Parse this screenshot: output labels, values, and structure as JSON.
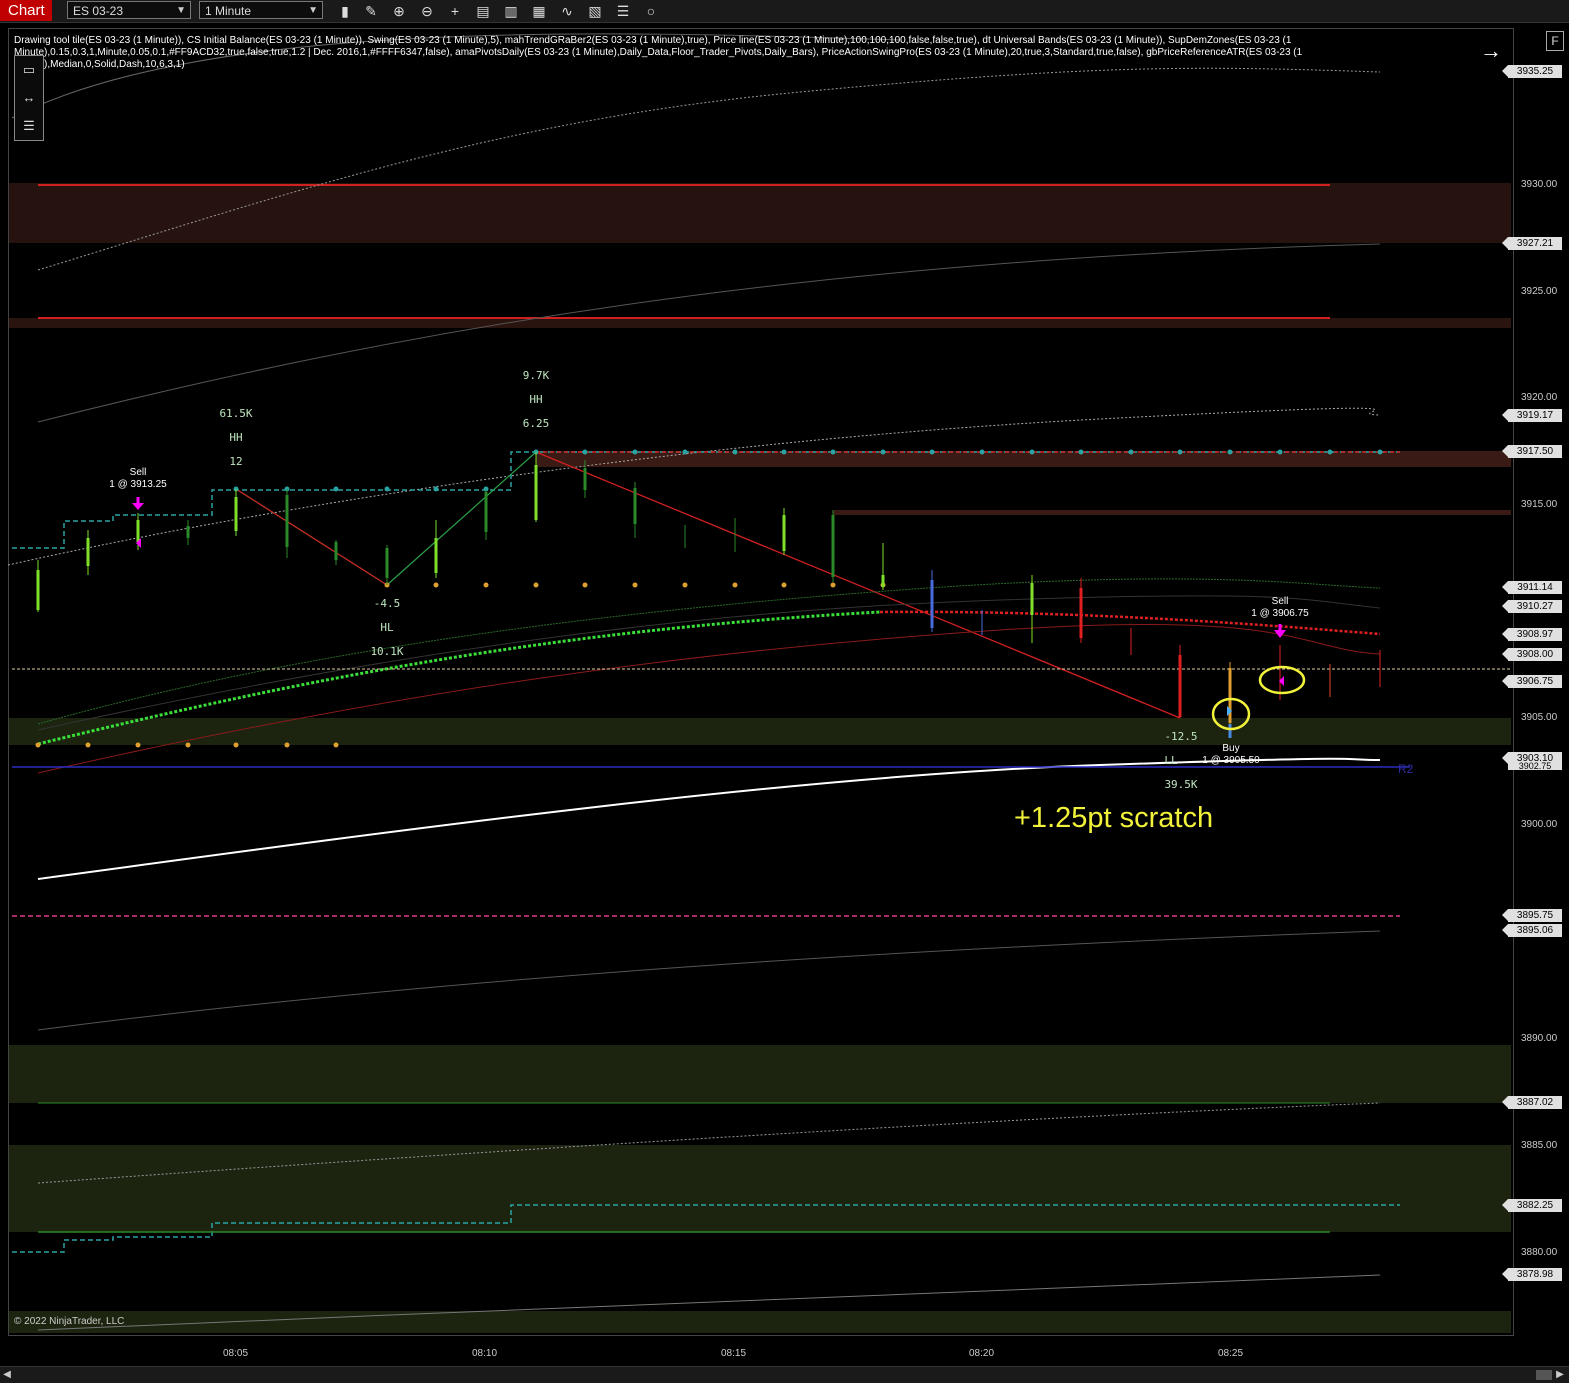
{
  "toolbar": {
    "tab_label": "Chart",
    "instrument": "ES 03-23",
    "interval": "1 Minute",
    "icons": [
      "bar-type-icon",
      "pencil-icon",
      "zoom-in-icon",
      "zoom-out-icon",
      "crosshair-icon",
      "properties-icon",
      "data-series-icon",
      "indicators-icon",
      "strategies-icon",
      "templates-icon",
      "list-icon",
      "order-panel-icon"
    ]
  },
  "indicators_text": "Drawing tool tile(ES 03-23 (1 Minute)), CS Initial Balance(ES 03-23 (1 Minute)), Swing(ES 03-23 (1 Minute),5), mahTrendGRaBer2(ES 03-23 (1 Minute),true), Price line(ES 03-23 (1 Minute),100,100,100,false,false,true), dt Universal Bands(ES 03-23 (1 Minute)), SupDemZones(ES 03-23 (1 Minute),0.15,0.3,1,Minute,0.05,0.1,#FF9ACD32,true,false,true,1.2 | Dec. 2016,1,#FFFF6347,false), amaPivotsDaily(ES 03-23 (1 Minute),Daily_Data,Floor_Trader_Pivots,Daily_Bars), PriceActionSwingPro(ES 03-23 (1 Minute),20,true,3,Standard,true,false), gbPriceReferenceATR(ES 03-23 (1 Minute),Median,0,Solid,Dash,10,6,3,1)",
  "f_button": "F",
  "price_axis": {
    "ticks": [
      "3930.00",
      "3925.00",
      "3920.00",
      "3915.00",
      "3905.00",
      "3900.00",
      "3890.00",
      "3885.00",
      "3880.00"
    ],
    "markers": [
      "3935.25",
      "3927.21",
      "3919.17",
      "3917.50",
      "3911.14",
      "3910.27",
      "3908.97",
      "3908.00",
      "3906.75",
      "3903.10",
      "3902.75",
      "3895.75",
      "3895.06",
      "3887.02",
      "3882.25",
      "3878.98"
    ]
  },
  "time_axis": [
    "08:05",
    "08:10",
    "08:15",
    "08:20",
    "08:25"
  ],
  "copyright": "© 2022 NinjaTrader, LLC",
  "swing_annotations": [
    {
      "volume": "61.5K",
      "label": "HH",
      "value": "12"
    },
    {
      "volume": "9.7K",
      "label": "HH",
      "value": "6.25"
    },
    {
      "value": "-4.5",
      "label": "HL",
      "volume": "10.1K"
    },
    {
      "value": "-12.5",
      "label": "LL",
      "volume": "39.5K"
    }
  ],
  "trades": [
    {
      "side": "Sell",
      "detail": "1 @ 3913.25"
    },
    {
      "side": "Sell",
      "detail": "1 @ 3906.75"
    },
    {
      "side": "Buy",
      "detail": "1 @ 3905.50"
    }
  ],
  "pivot_label": "R2",
  "note": "+1.25pt scratch",
  "colors": {
    "tab_bg": "#c00000",
    "up_candle": "#7fe02a",
    "down_candle": "#e02020",
    "note": "#f2f23a",
    "trade_arrow": "#ff00ff"
  }
}
